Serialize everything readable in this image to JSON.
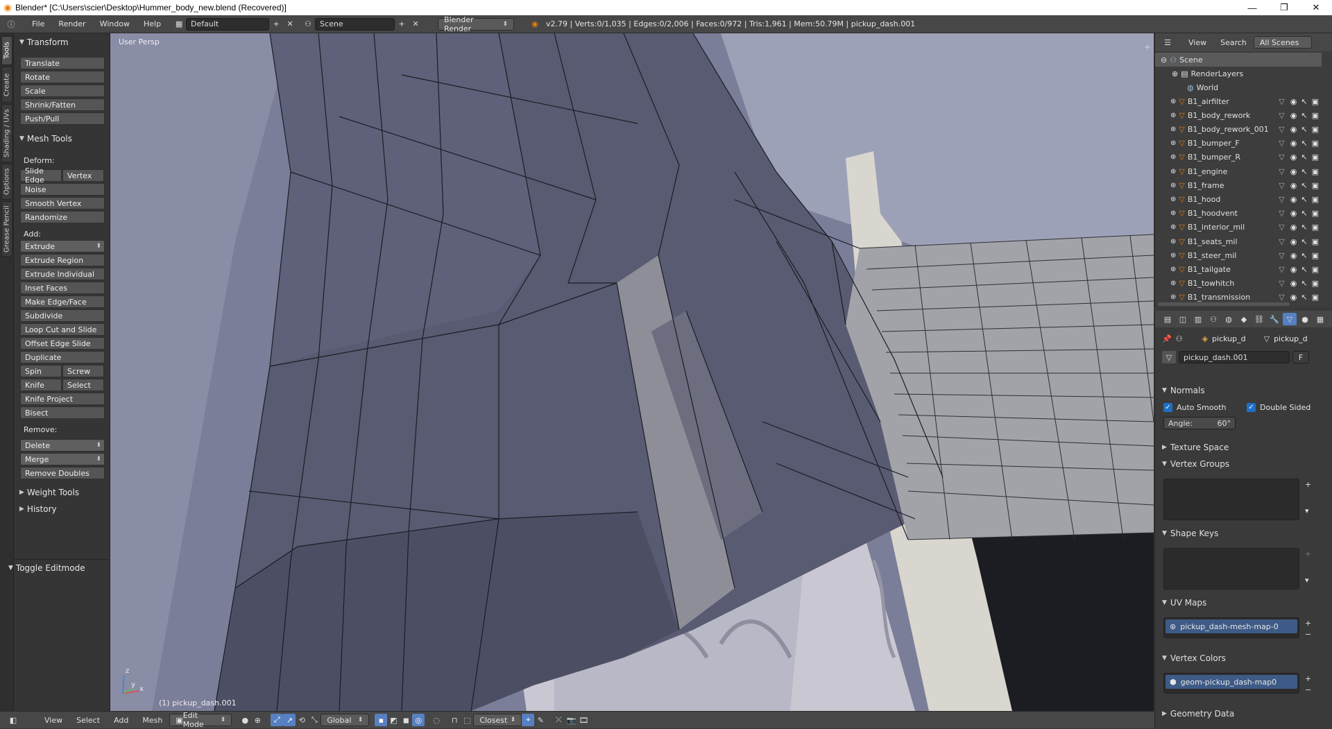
{
  "window": {
    "title": "Blender* [C:\\Users\\scier\\Desktop\\Hummer_body_new.blend (Recovered)]"
  },
  "info": {
    "menus": [
      "File",
      "Render",
      "Window",
      "Help"
    ],
    "screen_layout": "Default",
    "scene": "Scene",
    "render_engine": "Blender Render",
    "stats": "v2.79 | Verts:0/1,035 | Edges:0/2,006 | Faces:0/972 | Tris:1,961 | Mem:50.79M | pickup_dash.001"
  },
  "tabs": [
    "Tools",
    "Create",
    "Shading / UVs",
    "Options",
    "Grease Pencil"
  ],
  "tool_shelf": {
    "transform_header": "Transform",
    "transform": [
      "Translate",
      "Rotate",
      "Scale",
      "Shrink/Fatten",
      "Push/Pull"
    ],
    "mesh_tools_header": "Mesh Tools",
    "deform_label": "Deform:",
    "slide_edge": "Slide Edge",
    "vertex": "Vertex",
    "noise": "Noise",
    "smooth_vertex": "Smooth Vertex",
    "randomize": "Randomize",
    "add_label": "Add:",
    "extrude": "Extrude",
    "add_tools": [
      "Extrude Region",
      "Extrude Individual",
      "Inset Faces",
      "Make Edge/Face",
      "Subdivide",
      "Loop Cut and Slide",
      "Offset Edge Slide",
      "Duplicate"
    ],
    "spin": "Spin",
    "screw": "Screw",
    "knife": "Knife",
    "select": "Select",
    "knife_project": "Knife Project",
    "bisect": "Bisect",
    "remove_label": "Remove:",
    "delete": "Delete",
    "merge": "Merge",
    "remove_doubles": "Remove Doubles",
    "weight_tools": "Weight Tools",
    "history": "History",
    "toggle_editmode": "Toggle Editmode"
  },
  "viewport": {
    "view_name": "User Persp",
    "object_label": "(1) pickup_dash.001",
    "axis_x": "x",
    "axis_y": "y",
    "axis_z": "z"
  },
  "outliner": {
    "menus": [
      "View",
      "Search"
    ],
    "filter": "All Scenes",
    "scene": "Scene",
    "render_layers": "RenderLayers",
    "world": "World",
    "objects": [
      "B1_airfilter",
      "B1_body_rework",
      "B1_body_rework_001",
      "B1_bumper_F",
      "B1_bumper_R",
      "B1_engine",
      "B1_frame",
      "B1_hood",
      "B1_hoodvent",
      "B1_interior_mil",
      "B1_seats_mil",
      "B1_steer_mil",
      "B1_tailgate",
      "B1_towhitch",
      "B1_transmission"
    ]
  },
  "properties": {
    "object_name": "pickup_d",
    "mesh_name": "pickup_d",
    "datablock": "pickup_dash.001",
    "fake_user": "F",
    "normals_header": "Normals",
    "auto_smooth": "Auto Smooth",
    "double_sided": "Double Sided",
    "angle_label": "Angle:",
    "angle_value": "60°",
    "texture_space": "Texture Space",
    "vertex_groups": "Vertex Groups",
    "shape_keys": "Shape Keys",
    "uv_maps": "UV Maps",
    "uv_map_item": "pickup_dash-mesh-map-0",
    "vertex_colors": "Vertex Colors",
    "vertex_color_item": "geom-pickup_dash-map0",
    "geometry_data": "Geometry Data"
  },
  "bottom": {
    "menus": [
      "View",
      "Select",
      "Add",
      "Mesh"
    ],
    "mode": "Edit Mode",
    "orientation": "Global",
    "snap": "Closest"
  },
  "colors": {
    "accent": "#5680c2",
    "selection_blue": "#1f6fc7",
    "object_orange": "#e87d0d"
  }
}
